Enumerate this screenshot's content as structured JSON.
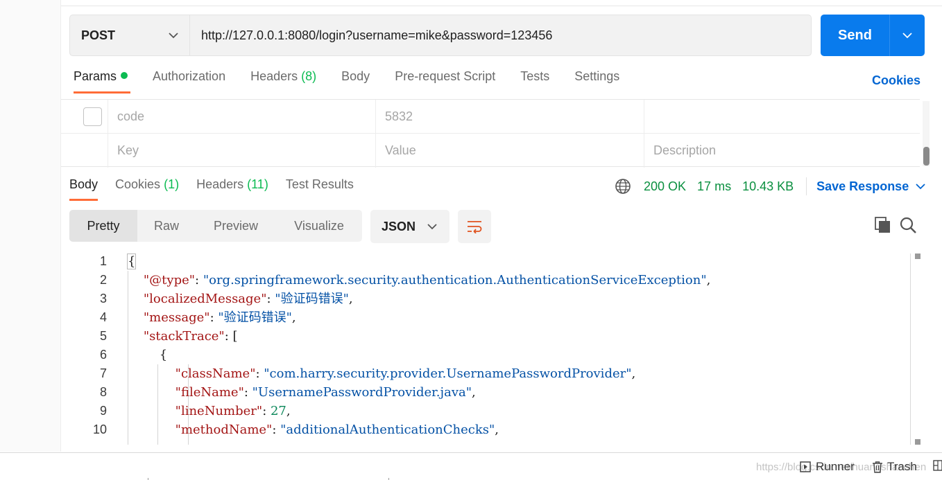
{
  "request": {
    "method": "POST",
    "url": "http://127.0.0.1:8080/login?username=mike&password=123456",
    "send_label": "Send"
  },
  "request_tabs": [
    {
      "label": "Params",
      "active": true,
      "has_dot": true
    },
    {
      "label": "Authorization"
    },
    {
      "label": "Headers",
      "count": "(8)"
    },
    {
      "label": "Body"
    },
    {
      "label": "Pre-request Script"
    },
    {
      "label": "Tests"
    },
    {
      "label": "Settings"
    }
  ],
  "cookies_link": "Cookies",
  "params": {
    "rows": [
      {
        "key": "code",
        "value": "5832",
        "description": ""
      }
    ],
    "placeholder": {
      "key": "Key",
      "value": "Value",
      "description": "Description"
    }
  },
  "response_tabs": [
    {
      "label": "Body",
      "active": true
    },
    {
      "label": "Cookies",
      "count": "(1)"
    },
    {
      "label": "Headers",
      "count": "(11)"
    },
    {
      "label": "Test Results"
    }
  ],
  "response_status": {
    "status": "200 OK",
    "time": "17 ms",
    "size": "10.43 KB",
    "save_label": "Save Response"
  },
  "view_modes": [
    "Pretty",
    "Raw",
    "Preview",
    "Visualize"
  ],
  "format": "JSON",
  "code": {
    "line_numbers": [
      "1",
      "2",
      "3",
      "4",
      "5",
      "6",
      "7",
      "8",
      "9",
      "10"
    ],
    "lines": {
      "l1": "{",
      "l2_key": "\"@type\"",
      "l2_val": "\"org.springframework.security.authentication.AuthenticationServiceException\"",
      "l3_key": "\"localizedMessage\"",
      "l3_val": "\"验证码错误\"",
      "l4_key": "\"message\"",
      "l4_val": "\"验证码错误\"",
      "l5_key": "\"stackTrace\"",
      "l5_rest": ": [",
      "l6": "{",
      "l7_key": "\"className\"",
      "l7_val": "\"com.harry.security.provider.UsernamePasswordProvider\"",
      "l8_key": "\"fileName\"",
      "l8_val": "\"UsernamePasswordProvider.java\"",
      "l9_key": "\"lineNumber\"",
      "l9_val": "27",
      "l10_key": "\"methodName\"",
      "l10_val": "\"additionalAuthenticationChecks\""
    }
  },
  "bottom_bar": {
    "runner": "Runner",
    "trash": "Trash",
    "watermark": "https://blog.csdn.net/huangshanchen"
  },
  "colors": {
    "accent": "#ff6c37",
    "send": "#097bed",
    "link": "#0265d2",
    "status_ok": "#0a8f3f",
    "json_key": "#a31515",
    "json_string": "#0451a5",
    "json_number": "#098658"
  }
}
